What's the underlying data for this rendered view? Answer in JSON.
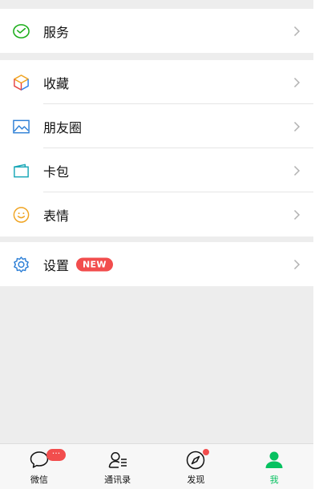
{
  "menu": {
    "services": {
      "label": "服务",
      "icon": "wechat-pay-icon"
    },
    "favorites": {
      "label": "收藏",
      "icon": "cube-icon"
    },
    "moments": {
      "label": "朋友圈",
      "icon": "image-icon"
    },
    "cards": {
      "label": "卡包",
      "icon": "card-wallet-icon"
    },
    "stickers": {
      "label": "表情",
      "icon": "smiley-icon"
    },
    "settings": {
      "label": "设置",
      "icon": "gear-icon",
      "badge": "NEW"
    }
  },
  "tabbar": {
    "tabs": [
      {
        "label": "微信",
        "icon": "chat-bubble-icon",
        "badge": "···"
      },
      {
        "label": "通讯录",
        "icon": "contacts-icon"
      },
      {
        "label": "发现",
        "icon": "compass-icon"
      },
      {
        "label": "我",
        "icon": "person-icon",
        "active": true
      }
    ]
  },
  "colors": {
    "accent": "#07c160",
    "badge": "#f24d4d",
    "background": "#ededed"
  }
}
